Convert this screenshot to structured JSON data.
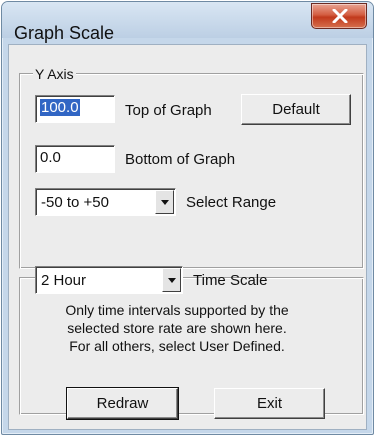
{
  "window": {
    "title": "Graph Scale"
  },
  "y_axis": {
    "legend": "Y Axis",
    "top": {
      "value": "100.0",
      "label": "Top of Graph"
    },
    "bottom": {
      "value": "0.0",
      "label": "Bottom of Graph"
    },
    "range": {
      "value": "-50 to +50",
      "label": "Select Range"
    },
    "default_button": "Default"
  },
  "time": {
    "scale": {
      "value": "2 Hour",
      "label": "Time Scale"
    },
    "info_lines": [
      "Only time intervals supported by the",
      "selected store rate are shown here.",
      "For all others, select User Defined."
    ]
  },
  "buttons": {
    "redraw": "Redraw",
    "exit": "Exit"
  },
  "icons": {
    "close": "close-icon",
    "dropdown": "chevron-down-icon"
  },
  "colors": {
    "close_button": "#c8462a",
    "selection": "#3166c4",
    "face": "#ececec"
  }
}
